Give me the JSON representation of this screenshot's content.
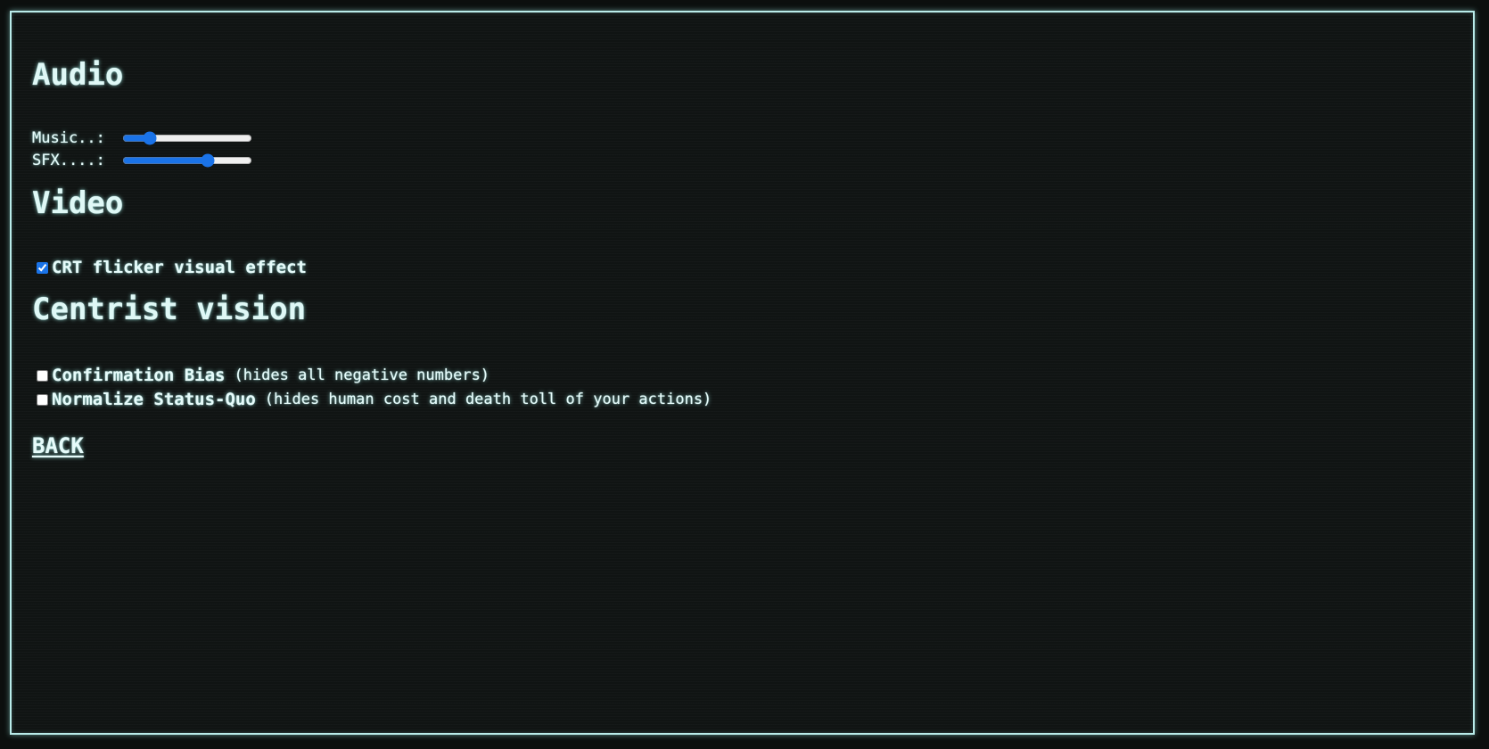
{
  "audio": {
    "heading": "Audio",
    "music": {
      "label": "Music..:",
      "value": 18
    },
    "sfx": {
      "label": "SFX....:",
      "value": 68
    }
  },
  "video": {
    "heading": "Video",
    "crt": {
      "label": "CRT flicker visual effect",
      "checked": true
    }
  },
  "centrist_vision": {
    "heading": "Centrist vision",
    "options": [
      {
        "label": "Confirmation Bias",
        "description": "(hides all negative numbers)",
        "checked": false
      },
      {
        "label": "Normalize Status-Quo",
        "description": "(hides human cost and death toll of your actions)",
        "checked": false
      }
    ]
  },
  "back_label": "BACK",
  "colors": {
    "background": "#101413",
    "text": "#e6fbfa",
    "glow": "#a0f0eb",
    "accent": "#1a73e8"
  }
}
